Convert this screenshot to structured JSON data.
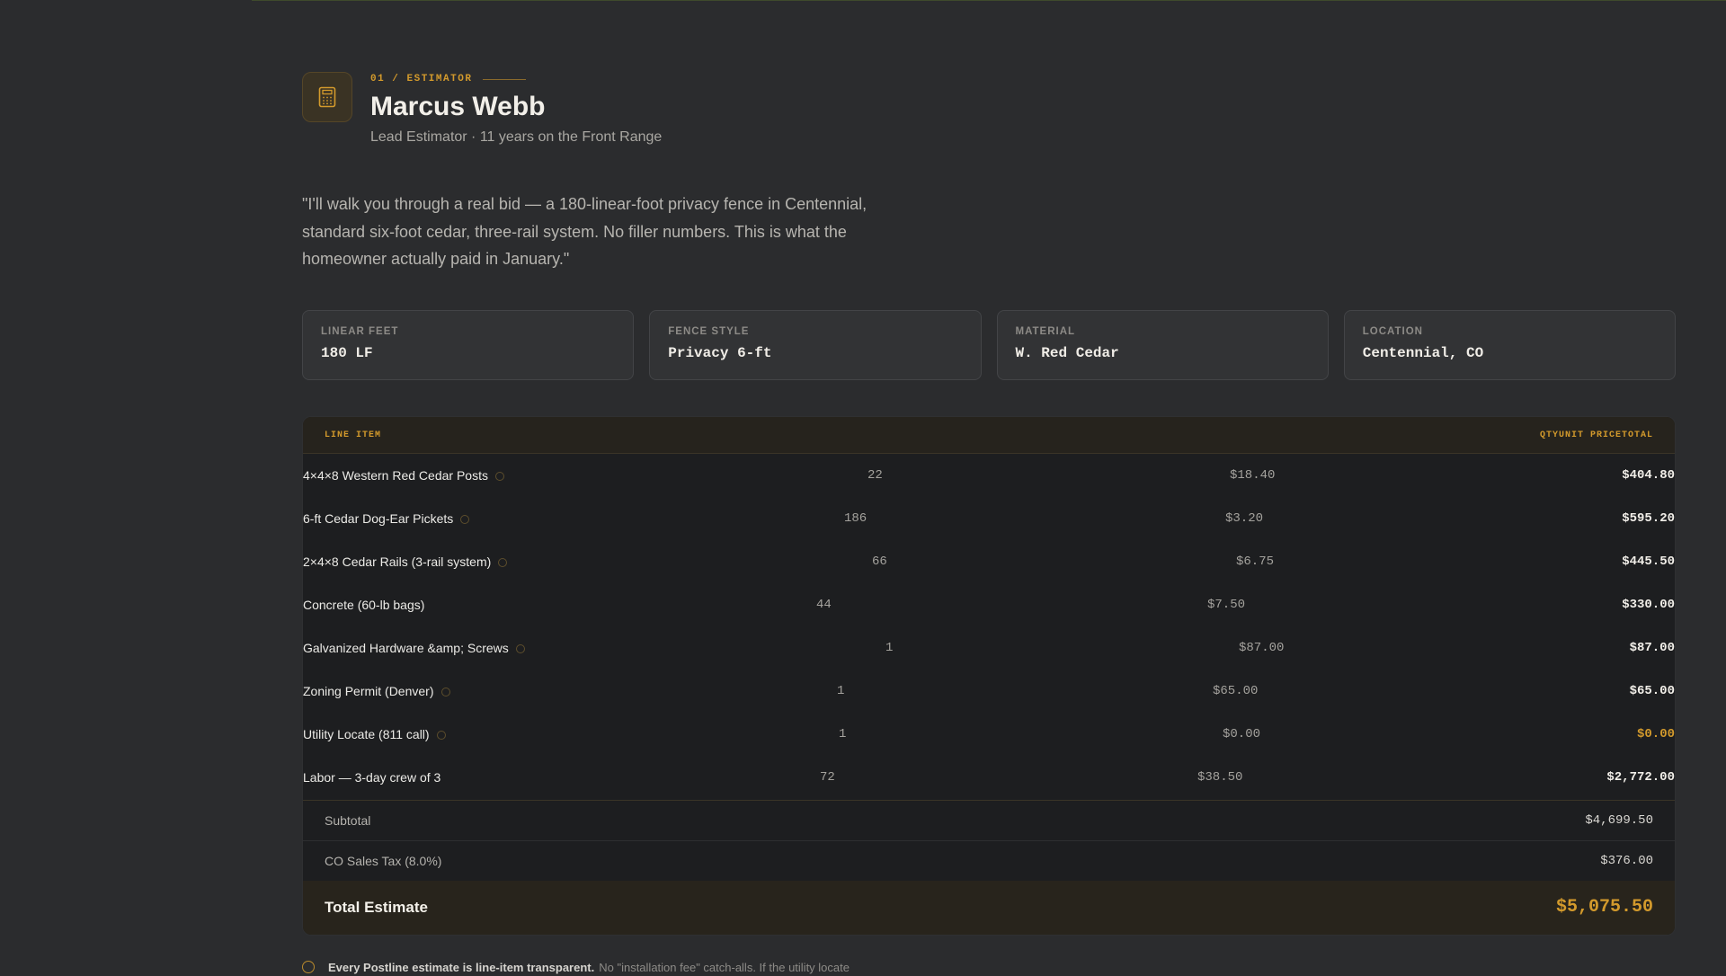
{
  "header": {
    "eyebrow": "01 / ESTIMATOR",
    "name": "Marcus Webb",
    "role": "Lead Estimator · 11 years on the Front Range",
    "icon": "calculator-icon"
  },
  "quote": "\"I'll walk you through a real bid — a 180-linear-foot privacy fence in Centennial, standard six-foot cedar, three-rail system. No filler numbers. This is what the homeowner actually paid in January.\"",
  "stats": [
    {
      "label": "LINEAR FEET",
      "value": "180 LF"
    },
    {
      "label": "FENCE STYLE",
      "value": "Privacy 6-ft"
    },
    {
      "label": "MATERIAL",
      "value": "W. Red Cedar"
    },
    {
      "label": "LOCATION",
      "value": "Centennial, CO"
    }
  ],
  "table": {
    "head_item": "LINE ITEM",
    "head_right": "QTYUNIT PRICETOTAL",
    "rows": [
      {
        "name": "4×4×8 Western Red Cedar Posts",
        "qty": "22",
        "unit": "$18.40",
        "total": "$404.80",
        "info": true
      },
      {
        "name": "6-ft Cedar Dog-Ear Pickets",
        "qty": "186",
        "unit": "$3.20",
        "total": "$595.20",
        "info": true
      },
      {
        "name": "2×4×8 Cedar Rails (3-rail system)",
        "qty": "66",
        "unit": "$6.75",
        "total": "$445.50",
        "info": true
      },
      {
        "name": "Concrete (60-lb bags)",
        "qty": "44",
        "unit": "$7.50",
        "total": "$330.00",
        "info": false
      },
      {
        "name": "Galvanized Hardware &amp; Screws",
        "qty": "1",
        "unit": "$87.00",
        "total": "$87.00",
        "info": true
      },
      {
        "name": "Zoning Permit (Denver)",
        "qty": "1",
        "unit": "$65.00",
        "total": "$65.00",
        "info": true
      },
      {
        "name": "Utility Locate (811 call)",
        "qty": "1",
        "unit": "$0.00",
        "total": "$0.00",
        "info": true
      },
      {
        "name": "Labor — 3-day crew of 3",
        "qty": "72",
        "unit": "$38.50",
        "total": "$2,772.00",
        "info": false
      }
    ],
    "subtotal_label": "Subtotal",
    "subtotal_value": "$4,699.50",
    "tax_label": "CO Sales Tax (8.0%)",
    "tax_value": "$376.00",
    "total_label": "Total Estimate",
    "total_value": "$5,075.50"
  },
  "footnote": {
    "strong": "Every Postline estimate is line-item transparent.",
    "text": "No \"installation fee\" catch-alls. If the utility locate"
  },
  "colors": {
    "accent": "#d39a2c",
    "background": "#2b2c2e",
    "table_bg": "#1d1e20"
  }
}
